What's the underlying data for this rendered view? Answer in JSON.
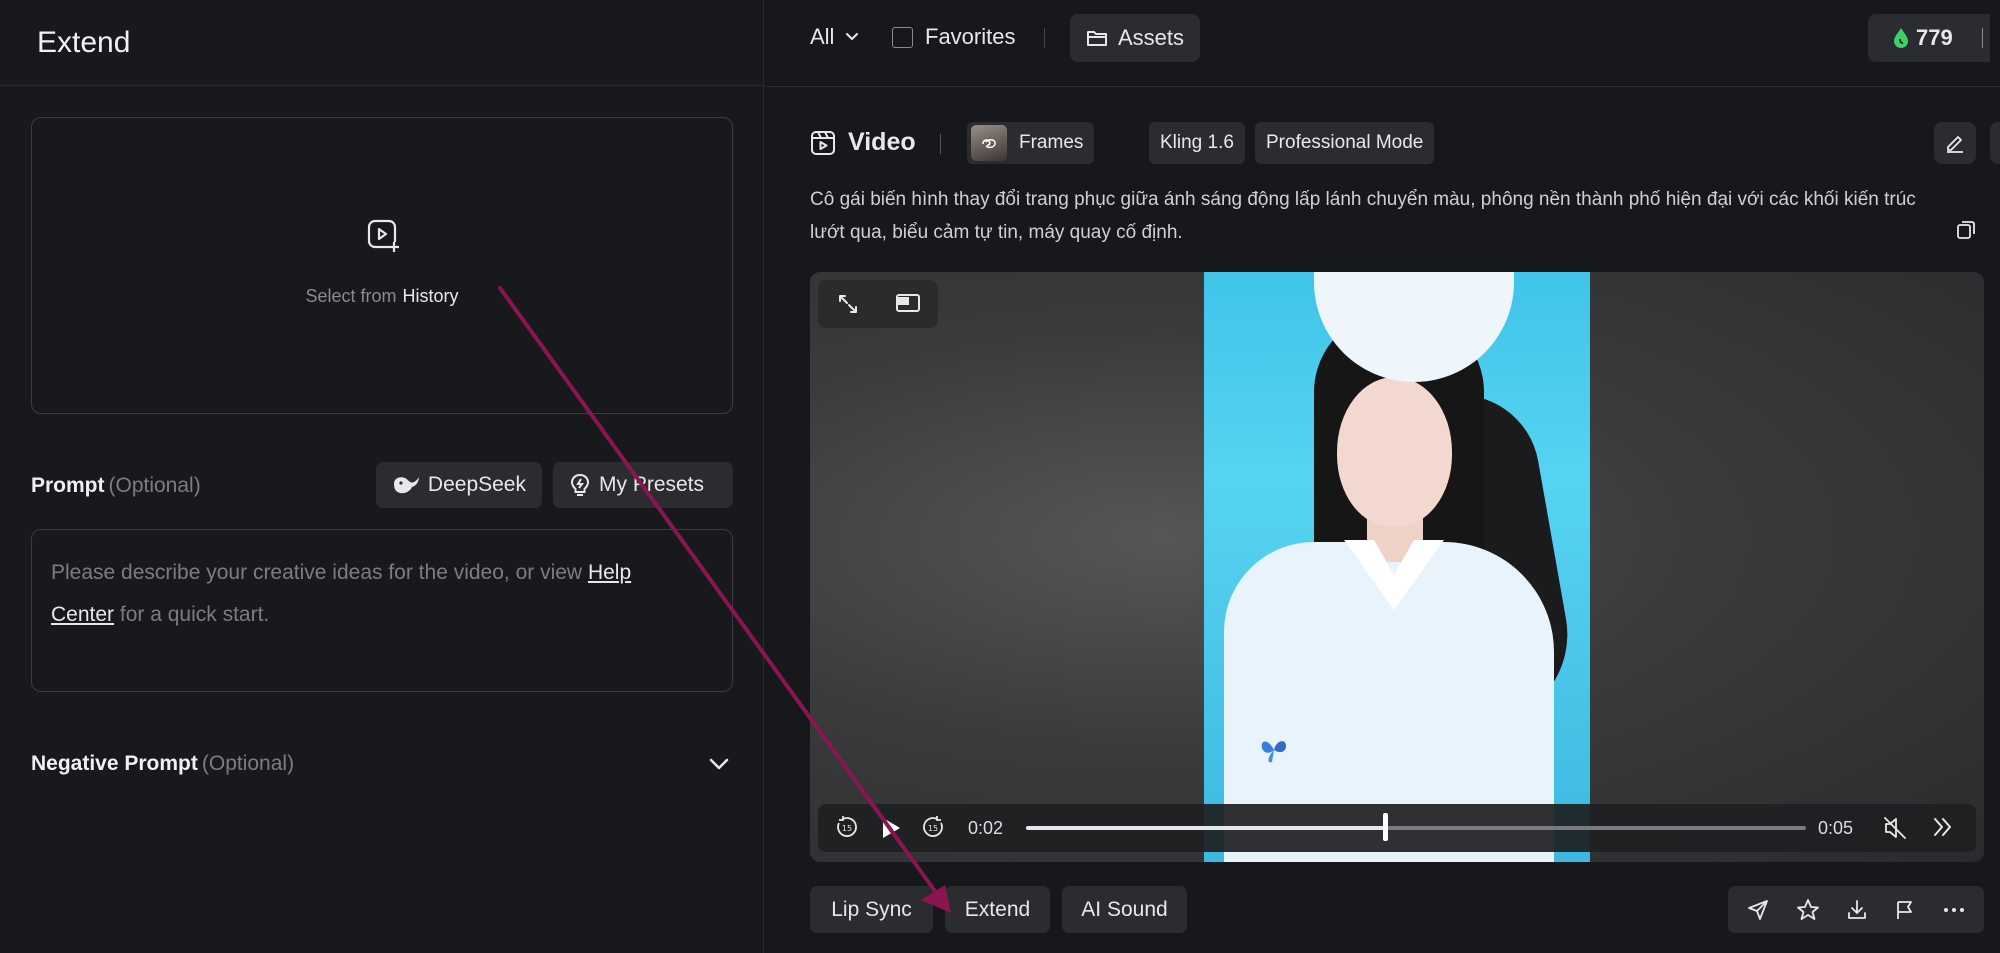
{
  "left_panel": {
    "title": "Extend",
    "upload": {
      "select_from": "Select from",
      "history": "History"
    },
    "prompt": {
      "label": "Prompt",
      "optional": "(Optional)",
      "deepseek": "DeepSeek",
      "my_presets": "My Presets",
      "placeholder_before": "Please describe your creative ideas for the video, or view ",
      "help_link_1": "Help",
      "help_link_2": "Center",
      "placeholder_after": " for a quick start."
    },
    "negative_prompt": {
      "label": "Negative Prompt",
      "optional": "(Optional)"
    }
  },
  "topbar": {
    "filter": "All",
    "favorites": "Favorites",
    "assets": "Assets",
    "credits": "779",
    "credit_color": "#3dd16b"
  },
  "video": {
    "title": "Video",
    "tags": [
      "Frames",
      "Kling 1.6",
      "Professional Mode"
    ],
    "description": "Cô gái biến hình thay đổi trang phục giữa ánh sáng động lấp lánh chuyển màu, phông nền thành phố hiện đại với các khối kiến trúc lướt qua, biểu cảm tự tin, máy quay cố định.",
    "player": {
      "current_time": "0:02",
      "duration": "0:05",
      "progress": 0.46,
      "skip_back": "15",
      "skip_forward": "15",
      "muted": true
    }
  },
  "actions": {
    "lip_sync": "Lip Sync",
    "extend": "Extend",
    "ai_sound": "AI Sound"
  },
  "annotation": {
    "arrow_color": "#8b1553"
  }
}
